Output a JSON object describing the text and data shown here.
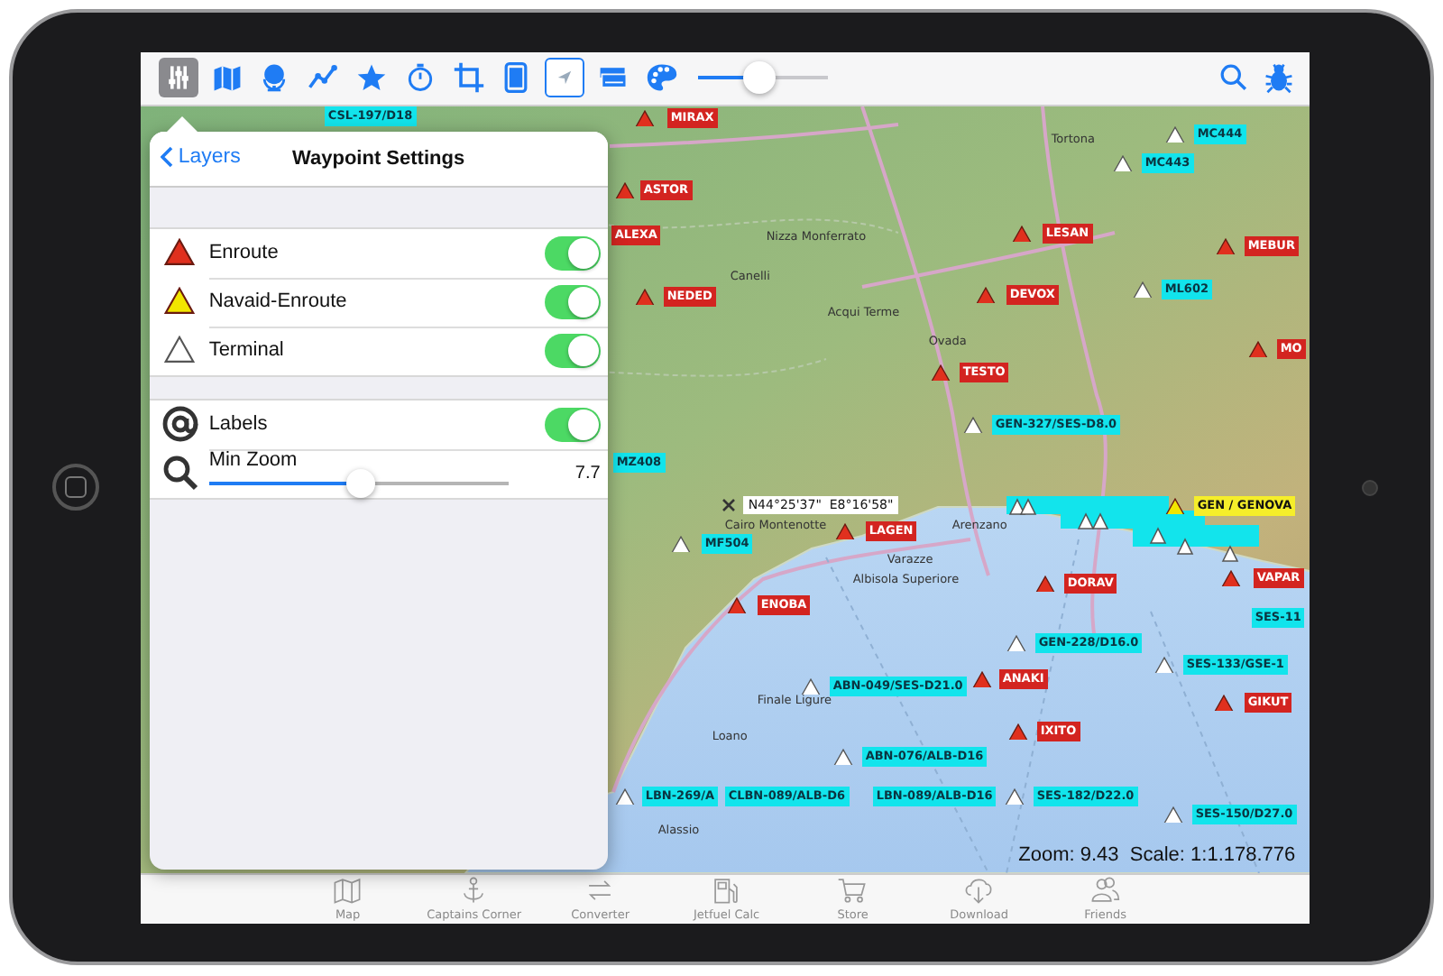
{
  "toolbar": {
    "tools": [
      {
        "selected": true,
        "toggled": false
      },
      {
        "selected": false,
        "toggled": false
      },
      {
        "selected": false,
        "toggled": false
      },
      {
        "selected": false,
        "toggled": false
      },
      {
        "selected": false,
        "toggled": false
      },
      {
        "selected": false,
        "toggled": false
      },
      {
        "selected": false,
        "toggled": false
      },
      {
        "selected": false,
        "toggled": false
      },
      {
        "selected": false,
        "toggled": true
      },
      {
        "selected": false,
        "toggled": false
      },
      {
        "selected": false,
        "toggled": false
      }
    ],
    "slider": {
      "level": 0.48
    }
  },
  "map": {
    "towns": [
      "Tortona",
      "Nizza Monferrato",
      "Canelli",
      "Acqui Terme",
      "Ovada",
      "Cairo Montenotte",
      "Arenzano",
      "Varazze",
      "Albisola Superiore",
      "Finale Ligure",
      "Loano",
      "Alassio"
    ],
    "waypoints": [
      {
        "kind": "terminal",
        "label": "CSL-197/D18"
      },
      {
        "kind": "enroute",
        "label": "MIRAX"
      },
      {
        "kind": "terminal",
        "label": "MC444"
      },
      {
        "kind": "terminal",
        "label": "MC443"
      },
      {
        "kind": "enroute",
        "label": "ASTOR"
      },
      {
        "kind": "enroute",
        "label": "LESAN"
      },
      {
        "kind": "enroute",
        "label": "ALEXA"
      },
      {
        "kind": "enroute",
        "label": "MEBUR"
      },
      {
        "kind": "enroute",
        "label": "NEDED"
      },
      {
        "kind": "enroute",
        "label": "DEVOX"
      },
      {
        "kind": "terminal",
        "label": "ML602"
      },
      {
        "kind": "enroute",
        "label": "MO"
      },
      {
        "kind": "enroute",
        "label": "TESTO"
      },
      {
        "kind": "terminal",
        "label": "GEN-327/SES-D8.0"
      },
      {
        "kind": "terminal",
        "label": "MZ408"
      },
      {
        "kind": "navaid",
        "label": "GEN / GENOVA"
      },
      {
        "kind": "enroute",
        "label": "LAGEN"
      },
      {
        "kind": "terminal",
        "label": "MF504"
      },
      {
        "kind": "enroute",
        "label": "ENOBA"
      },
      {
        "kind": "enroute",
        "label": "DORAV"
      },
      {
        "kind": "enroute",
        "label": "VAPAR"
      },
      {
        "kind": "terminal",
        "label": "SES-11"
      },
      {
        "kind": "terminal",
        "label": "GEN-228/D16.0"
      },
      {
        "kind": "terminal",
        "label": "ABN-049/SES-D21.0"
      },
      {
        "kind": "enroute",
        "label": "ANAKI"
      },
      {
        "kind": "terminal",
        "label": "SES-133/GSE-1"
      },
      {
        "kind": "enroute",
        "label": "GIKUT"
      },
      {
        "kind": "enroute",
        "label": "IXITO"
      },
      {
        "kind": "terminal",
        "label": "ABN-076/ALB-D16"
      },
      {
        "kind": "terminal",
        "label": "LBN-269/A"
      },
      {
        "kind": "terminal",
        "label": "CLBN-089/ALB-D6"
      },
      {
        "kind": "terminal",
        "label": "LBN-089/ALB-D16"
      },
      {
        "kind": "terminal",
        "label": "SES-182/D22.0"
      },
      {
        "kind": "terminal",
        "label": "SES-150/D27.0"
      }
    ],
    "cursor_coordinates": "N44°25'37\"  E8°16'58\"",
    "zoom_readout": "Zoom: 9.43  Scale: 1:1.178.776"
  },
  "popover": {
    "back": "Layers",
    "title": "Waypoint Settings",
    "sections": [
      {
        "rows": [
          {
            "kind": "toggle",
            "color": "#e0301e",
            "filled": true,
            "label": "Enroute",
            "on": true
          },
          {
            "kind": "toggle",
            "color": "#f2e600",
            "filled": true,
            "label": "Navaid-Enroute",
            "on": true
          },
          {
            "kind": "toggle",
            "color": "#555555",
            "filled": false,
            "label": "Terminal",
            "on": true
          }
        ]
      },
      {
        "rows": [
          {
            "kind": "toggle",
            "label": "Labels",
            "on": true
          },
          {
            "kind": "slider",
            "label": "Min Zoom",
            "level": 0.51,
            "reading": "7.7"
          }
        ]
      }
    ]
  },
  "tab_bar": [
    {
      "label": "Map"
    },
    {
      "label": "Captains Corner"
    },
    {
      "label": "Converter"
    },
    {
      "label": "Jetfuel Calc"
    },
    {
      "label": "Store"
    },
    {
      "label": "Download"
    },
    {
      "label": "Friends"
    }
  ]
}
